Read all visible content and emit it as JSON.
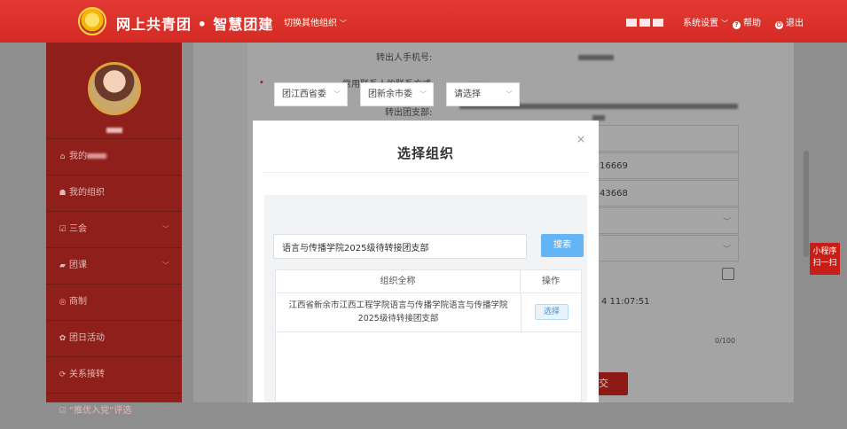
{
  "header": {
    "brand": "网上共青团 • 智慧团建",
    "switch_org": "切换其他组织",
    "settings": "系统设置",
    "help": "帮助",
    "logout": "退出",
    "colors": {
      "bar": "#d42a24"
    }
  },
  "sidebar": {
    "items": [
      {
        "label": "我的",
        "icon": "home-icon",
        "has_arrow": false
      },
      {
        "label": "我的组织",
        "icon": "users-icon",
        "has_arrow": false
      },
      {
        "label": "三会",
        "icon": "checkbox-icon",
        "has_arrow": true
      },
      {
        "label": "团课",
        "icon": "folder-icon",
        "has_arrow": true
      },
      {
        "label": "商制",
        "icon": "circle-icon",
        "has_arrow": false
      },
      {
        "label": "团日活动",
        "icon": "activity-icon",
        "has_arrow": false
      },
      {
        "label": "关系接转",
        "icon": "transfer-icon",
        "has_arrow": false
      },
      {
        "label": "“推优入党”评选",
        "icon": "checkbox-icon",
        "has_arrow": true
      }
    ]
  },
  "form_bg": {
    "phone_label": "转出人手机号:",
    "contact_label": "常用联系人的联系方式",
    "branch_label": "转出团支部:",
    "value_1": "16669",
    "value_2": "43668",
    "date": "4 11:07:51",
    "counter": "0/100",
    "submit_label": "交",
    "required_mark": "•"
  },
  "mini_program": {
    "line1": "小程序",
    "line2": "扫一扫"
  },
  "modal": {
    "title": "选择组织",
    "close": "×",
    "selects": [
      "团江西省委",
      "团新余市委",
      "请选择"
    ],
    "search_value": "语言与传播学院2025级待转接团支部",
    "search_button": "搜索",
    "table": {
      "headers": [
        "组织全称",
        "操作"
      ],
      "rows": [
        {
          "name": "江西省新余市江西工程学院语言与传播学院语言与传播学院2025级待转接团支部",
          "action": "选择"
        }
      ]
    },
    "colors": {
      "search_button": "#64b5f6"
    }
  }
}
